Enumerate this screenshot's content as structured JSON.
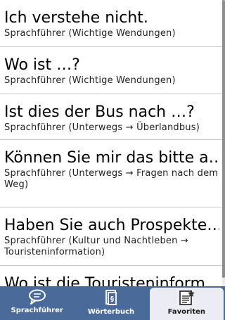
{
  "items": [
    {
      "title": "Ich verstehe nicht.",
      "subtitle": "Sprachführer (Wichtige Wendungen)"
    },
    {
      "title": "Wo ist …?",
      "subtitle": "Sprachführer (Wichtige Wendungen)"
    },
    {
      "title": "Ist dies der Bus nach …?",
      "subtitle": "Sprachführer (Unterwegs → Überlandbus)"
    },
    {
      "title": "Können Sie mir das bitte a…",
      "subtitle": "Sprachführer (Unterwegs → Fragen nach dem Weg)"
    },
    {
      "title": "Haben Sie auch Prospekte…",
      "subtitle": "Sprachführer (Kultur und Nachtleben → Touristeninformation)"
    },
    {
      "title": "Wo ist die Touristeninform…",
      "subtitle": ""
    }
  ],
  "tabs": [
    {
      "label": "Sprachführer",
      "icon": "speech-bubble-icon",
      "active": false
    },
    {
      "label": "Wörterbuch",
      "icon": "dictionary-icon",
      "active": false
    },
    {
      "label": "Favoriten",
      "icon": "favorites-icon",
      "active": true
    }
  ],
  "colors": {
    "tabbar": "#4a6a9a",
    "active_tab": "#ececf4",
    "divider": "#c8c8c8"
  }
}
